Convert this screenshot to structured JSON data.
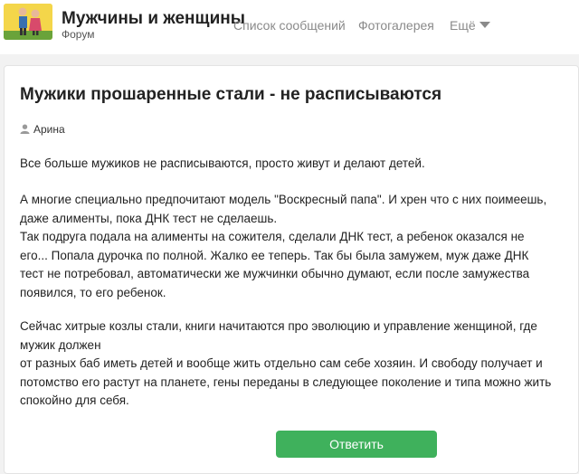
{
  "site": {
    "title": "Мужчины и женщины",
    "subtitle": "Форум"
  },
  "nav": {
    "messages": "Список сообщений",
    "gallery": "Фотогалерея",
    "more": "Ещё"
  },
  "post": {
    "title": "Мужики прошаренные стали - не расписываются",
    "author": "Арина",
    "paragraphs": [
      [
        "Все больше мужиков не расписываются, просто живут и делают детей."
      ],
      [
        "А многие специально предпочитают модель \"Воскресный папа\". И хрен что с них поимеешь,",
        "даже алименты, пока ДНК тест не сделаешь.",
        "Так подруга подала на алименты на сожителя, сделали ДНК тест, а ребенок оказался не",
        "его... Попала дурочка по полной. Жалко ее теперь. Так бы была замужем, муж даже ДНК",
        "тест не потребовал, автоматически же мужчинки обычно думают, если после замужества",
        "появился, то его ребенок."
      ],
      [
        "Сейчас хитрые козлы стали, книги начитаются про эволюцию и управление женщиной, где",
        "мужик должен",
        "от разных баб иметь детей и вообще жить отдельно сам себе хозяин. И свободу получает и",
        "потомство его растут на планете, гены переданы в следующее поколение и типа можно жить",
        "спокойно для себя."
      ]
    ]
  },
  "reply_button": "Ответить",
  "colors": {
    "accent": "#3fb15c",
    "logo_bg": "#f4d64a",
    "nav_text": "#8a8a8a"
  },
  "icons": {
    "logo": "forum-logo-icon",
    "author": "user-icon",
    "more": "chevron-down-icon"
  }
}
